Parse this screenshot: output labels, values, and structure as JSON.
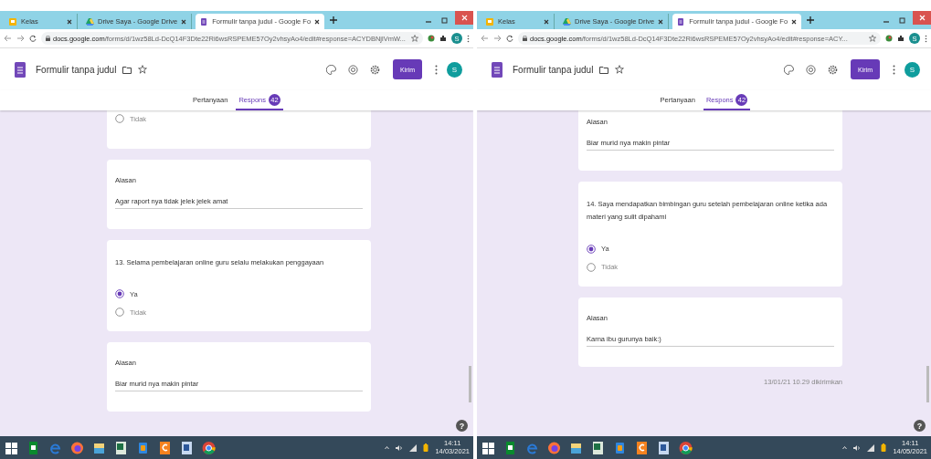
{
  "panes": [
    {
      "tabs": [
        {
          "kind": "classroom",
          "label": "Kelas",
          "selected": false
        },
        {
          "kind": "drive",
          "label": "Drive Saya - Google Drive",
          "selected": false
        },
        {
          "kind": "forms",
          "label": "Formulir tanpa judul - Google Fo",
          "selected": true
        }
      ],
      "url_host": "docs.google.com",
      "url_path": "/forms/d/1wz58Ld-DcQ14F3Dte22Ri6wsRSPEME57Oy2vhsyAo4/edit#response=ACYDBNjlVmW...",
      "profile": "S",
      "form_title": "Formulir tanpa judul",
      "send_button": "Kirim",
      "avatar": "S",
      "form_tabs": [
        {
          "label": "Pertanyaan",
          "selected": false
        },
        {
          "label": "Respons",
          "selected": true,
          "badge": "42"
        }
      ],
      "help": "?",
      "cards": [
        {
          "kind": "choice",
          "options": [
            {
              "label": "Tidak",
              "selected": false
            }
          ]
        },
        {
          "kind": "answer",
          "label": "Alasan",
          "answer": "Agar raport nya tidak jelek jelek amat"
        },
        {
          "kind": "choice",
          "question": "13. Selama pembelajaran online guru selalu melakukan penggayaan",
          "options": [
            {
              "label": "Ya",
              "selected": true
            },
            {
              "label": "Tidak",
              "selected": false
            }
          ]
        },
        {
          "kind": "answer",
          "label": "Alasan",
          "answer": "Biar murid nya makin pintar"
        }
      ],
      "taskbar": {
        "time": "14:11",
        "date": "14/03/2021"
      }
    },
    {
      "tabs": [
        {
          "kind": "classroom",
          "label": "Kelas",
          "selected": false
        },
        {
          "kind": "drive",
          "label": "Drive Saya - Google Drive",
          "selected": false
        },
        {
          "kind": "forms",
          "label": "Formulir tanpa judul - Google Fo",
          "selected": true
        }
      ],
      "url_host": "docs.google.com",
      "url_path": "/forms/d/1wz58Ld-DcQ14F3Dte22Ri6wsRSPEME57Oy2vhsyAo4/edit#response=ACY...",
      "profile": "S",
      "form_title": "Formulir tanpa judul",
      "send_button": "Kirim",
      "avatar": "S",
      "form_tabs": [
        {
          "label": "Pertanyaan",
          "selected": false
        },
        {
          "label": "Respons",
          "selected": true,
          "badge": "42"
        }
      ],
      "help": "?",
      "cards": [
        {
          "kind": "answer",
          "label": "Alasan",
          "answer": "Biar murid nya makin pintar"
        },
        {
          "kind": "choice",
          "question": "14. Saya mendapatkan bimbingan guru setelah pembelajaran online ketika ada materi yang sulit dipahami",
          "options": [
            {
              "label": "Ya",
              "selected": true
            },
            {
              "label": "Tidak",
              "selected": false
            }
          ]
        },
        {
          "kind": "answer",
          "label": "Alasan",
          "answer": "Karna ibu gurunya baik:)"
        }
      ],
      "submitted": "13/01/21 10.29 dikirimkan",
      "taskbar": {
        "time": "14:11",
        "date": "14/05/2021"
      }
    }
  ]
}
